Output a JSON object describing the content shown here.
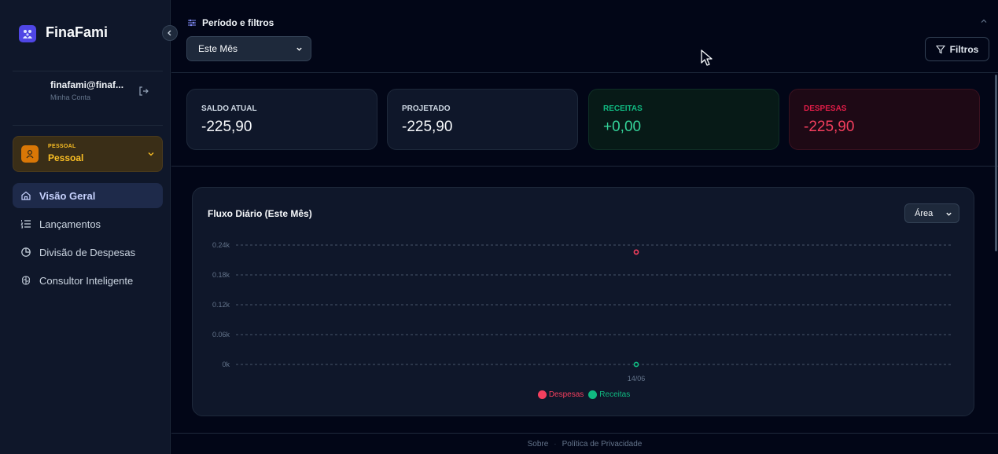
{
  "brand": {
    "name": "FinaFami"
  },
  "user": {
    "email": "finafami@finaf...",
    "subtitle": "Minha Conta"
  },
  "context": {
    "label": "PESSOAL",
    "name": "Pessoal"
  },
  "nav": {
    "items": [
      {
        "label": "Visão Geral",
        "icon": "home-icon",
        "active": true
      },
      {
        "label": "Lançamentos",
        "icon": "list-icon",
        "active": false
      },
      {
        "label": "Divisão de Despesas",
        "icon": "pie-icon",
        "active": false
      },
      {
        "label": "Consultor Inteligente",
        "icon": "brain-icon",
        "active": false
      }
    ]
  },
  "filters": {
    "title": "Período e filtros",
    "period": "Este Mês",
    "button": "Filtros"
  },
  "stats": [
    {
      "label": "SALDO ATUAL",
      "value": "-225,90",
      "tone": "neutral"
    },
    {
      "label": "PROJETADO",
      "value": "-225,90",
      "tone": "neutral"
    },
    {
      "label": "RECEITAS",
      "value": "+0,00",
      "tone": "green"
    },
    {
      "label": "DESPESAS",
      "value": "-225,90",
      "tone": "red"
    }
  ],
  "chart": {
    "title": "Fluxo Diário (Este Mês)",
    "type_selector": "Área"
  },
  "chart_data": {
    "type": "area",
    "title": "Fluxo Diário (Este Mês)",
    "x": [
      "14/06"
    ],
    "ylim": [
      0,
      0.24
    ],
    "ytick_labels": [
      "0.24k",
      "0.18k",
      "0.12k",
      "0.06k",
      "0k"
    ],
    "ytick_values": [
      0.24,
      0.18,
      0.12,
      0.06,
      0
    ],
    "grid": true,
    "legend_position": "bottom-center",
    "series": [
      {
        "name": "Despesas",
        "values": [
          0.2259
        ],
        "color": "#f43f5e"
      },
      {
        "name": "Receitas",
        "values": [
          0
        ],
        "color": "#10b981"
      }
    ]
  },
  "footer": {
    "links": [
      "Sobre",
      "Política de Privacidade"
    ]
  },
  "colors": {
    "accent": "#4f46e5",
    "positive": "#10b981",
    "negative": "#f43f5e",
    "context": "#fbbf24"
  }
}
